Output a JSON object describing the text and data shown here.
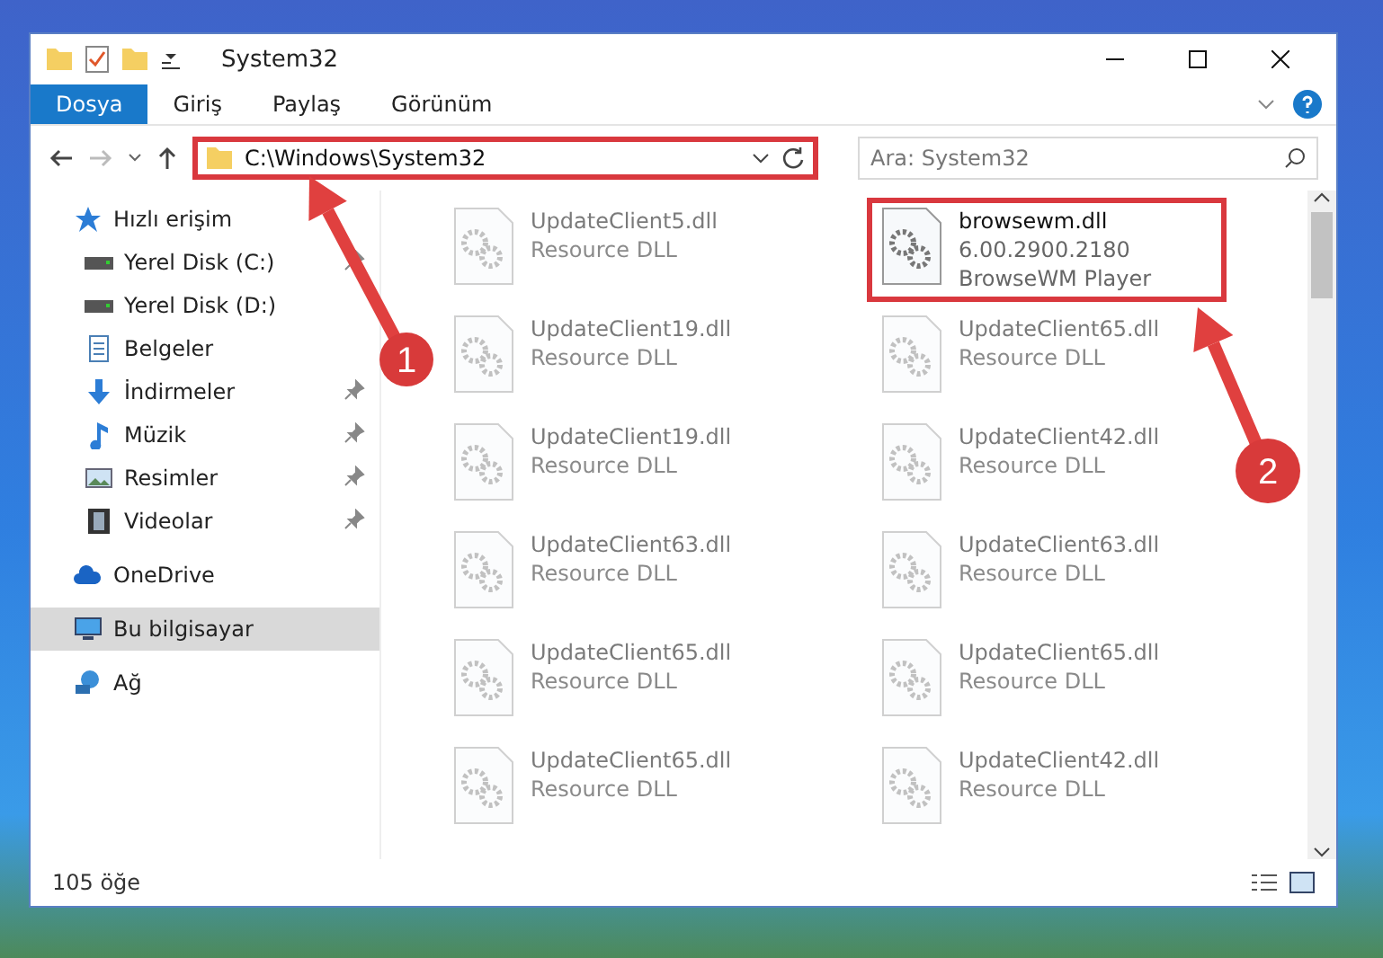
{
  "window": {
    "title": "System32"
  },
  "ribbon_tabs": [
    {
      "label": "Dosya",
      "selected": true
    },
    {
      "label": "Giriş",
      "selected": false
    },
    {
      "label": "Paylaş",
      "selected": false
    },
    {
      "label": "Görünüm",
      "selected": false
    }
  ],
  "address": {
    "value": "C:\\Windows\\System32",
    "highlighted": true
  },
  "search": {
    "placeholder": "Ara: System32"
  },
  "sidebar": {
    "items": [
      {
        "label": "Hızlı erişim",
        "kind": "star",
        "pinned": false,
        "selected": false,
        "children": [
          {
            "label": "Yerel Disk (C:)",
            "kind": "disk",
            "pinned": true,
            "selected": false
          },
          {
            "label": "Yerel Disk (D:)",
            "kind": "disk",
            "pinned": false,
            "selected": false
          },
          {
            "label": "Belgeler",
            "kind": "docs",
            "pinned": false,
            "selected": false
          },
          {
            "label": "İndirmeler",
            "kind": "download",
            "pinned": true,
            "selected": false
          },
          {
            "label": "Müzik",
            "kind": "music",
            "pinned": true,
            "selected": false
          },
          {
            "label": "Resimler",
            "kind": "pictures",
            "pinned": true,
            "selected": false
          },
          {
            "label": "Videolar",
            "kind": "videos",
            "pinned": true,
            "selected": false
          }
        ]
      },
      {
        "label": "OneDrive",
        "kind": "cloud",
        "pinned": false,
        "selected": false
      },
      {
        "label": "Bu bilgisayar",
        "kind": "pc",
        "pinned": false,
        "selected": true
      },
      {
        "label": "Ağ",
        "kind": "network",
        "pinned": false,
        "selected": false
      }
    ]
  },
  "files": [
    {
      "name": "UpdateClient5.dll",
      "lines": [
        "Resource DLL"
      ],
      "highlighted": false,
      "faded": true
    },
    {
      "name": "browsewm.dll",
      "lines": [
        "6.00.2900.2180",
        "BrowseWM Player"
      ],
      "highlighted": true,
      "faded": false
    },
    {
      "name": "UpdateClient19.dll",
      "lines": [
        "Resource DLL"
      ],
      "highlighted": false,
      "faded": true
    },
    {
      "name": "UpdateClient65.dll",
      "lines": [
        "Resource DLL"
      ],
      "highlighted": false,
      "faded": true
    },
    {
      "name": "UpdateClient19.dll",
      "lines": [
        "Resource DLL"
      ],
      "highlighted": false,
      "faded": true
    },
    {
      "name": "UpdateClient42.dll",
      "lines": [
        "Resource DLL"
      ],
      "highlighted": false,
      "faded": true
    },
    {
      "name": "UpdateClient63.dll",
      "lines": [
        "Resource DLL"
      ],
      "highlighted": false,
      "faded": true
    },
    {
      "name": "UpdateClient63.dll",
      "lines": [
        "Resource DLL"
      ],
      "highlighted": false,
      "faded": true
    },
    {
      "name": "UpdateClient65.dll",
      "lines": [
        "Resource DLL"
      ],
      "highlighted": false,
      "faded": true
    },
    {
      "name": "UpdateClient65.dll",
      "lines": [
        "Resource DLL"
      ],
      "highlighted": false,
      "faded": true
    },
    {
      "name": "UpdateClient65.dll",
      "lines": [
        "Resource DLL"
      ],
      "highlighted": false,
      "faded": true
    },
    {
      "name": "UpdateClient42.dll",
      "lines": [
        "Resource DLL"
      ],
      "highlighted": false,
      "faded": true
    }
  ],
  "status_bar": {
    "count": "105 öğe"
  },
  "annotations": [
    {
      "number": "1"
    },
    {
      "number": "2"
    }
  ]
}
